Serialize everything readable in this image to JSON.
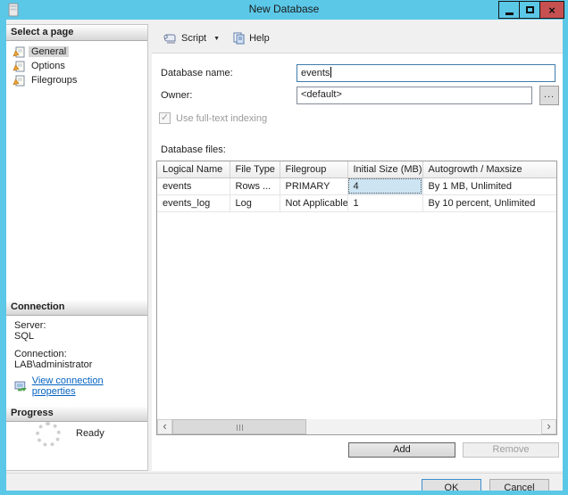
{
  "window": {
    "title": "New Database"
  },
  "toolbar": {
    "script": "Script",
    "help": "Help"
  },
  "sidebar": {
    "pages": {
      "header": "Select a page",
      "items": [
        {
          "label": "General",
          "selected": true
        },
        {
          "label": "Options",
          "selected": false
        },
        {
          "label": "Filegroups",
          "selected": false
        }
      ]
    },
    "connection": {
      "header": "Connection",
      "server_label": "Server:",
      "server_value": "SQL",
      "connection_label": "Connection:",
      "connection_value": "LAB\\administrator",
      "link_label": "View connection properties"
    },
    "progress": {
      "header": "Progress",
      "status": "Ready"
    }
  },
  "form": {
    "database_name_label": "Database name:",
    "database_name_value": "events",
    "owner_label": "Owner:",
    "owner_value": "<default>",
    "browse_button": "...",
    "fulltext_checkbox_label": "Use full-text indexing",
    "fulltext_checked": true,
    "files_label": "Database files:"
  },
  "grid": {
    "columns": [
      "Logical Name",
      "File Type",
      "Filegroup",
      "Initial Size (MB)",
      "Autogrowth / Maxsize"
    ],
    "rows": [
      [
        "events",
        "Rows ...",
        "PRIMARY",
        "4",
        "By 1 MB, Unlimited"
      ],
      [
        "events_log",
        "Log",
        "Not Applicable",
        "1",
        "By 10 percent, Unlimited"
      ]
    ],
    "selected_cell": {
      "row": 0,
      "column": 3,
      "value": "4"
    }
  },
  "buttons": {
    "add": "Add",
    "remove": "Remove",
    "ok": "OK",
    "cancel": "Cancel"
  },
  "icons": {
    "close": "×",
    "dropdown": "▼",
    "check": "✓",
    "scroll_left": "‹",
    "scroll_right": "›"
  },
  "colors": {
    "titlebar": "#5bc8e8",
    "close_button": "#c75050",
    "link": "#0563c1",
    "selected_cell": "#cde4f3",
    "body": "#f0f0f0"
  }
}
